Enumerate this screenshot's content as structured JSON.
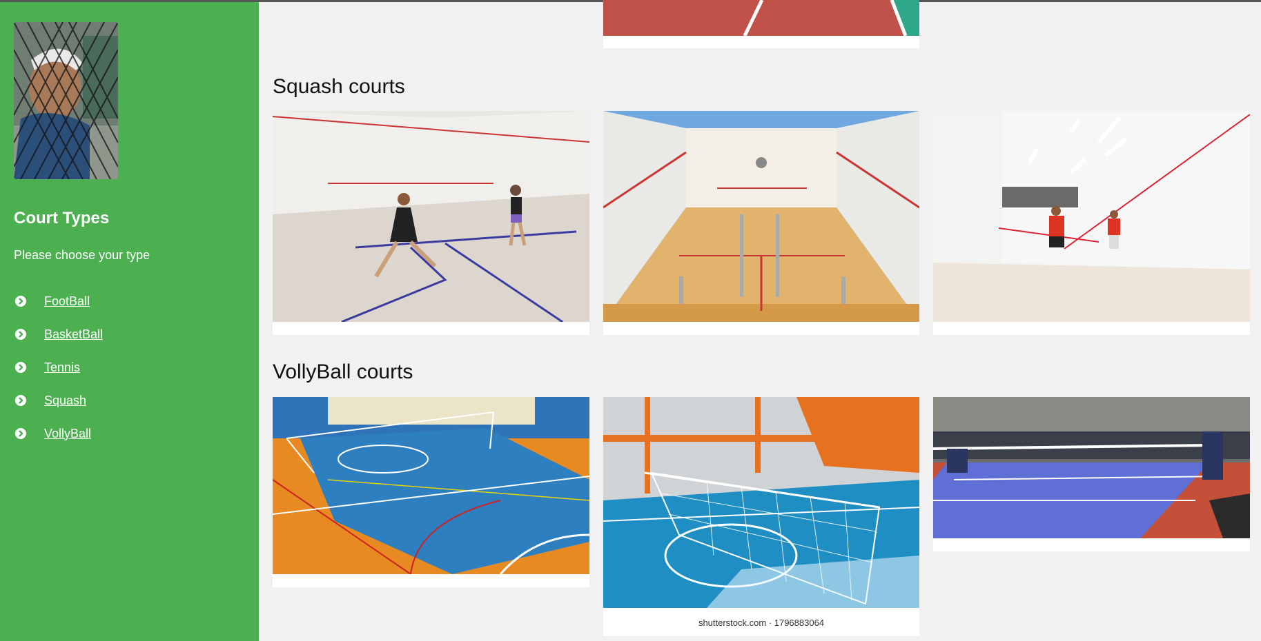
{
  "sidebar": {
    "avatar_icon": "player-photo",
    "title": "Court Types",
    "subtitle": "Please choose your type",
    "nav": [
      {
        "label": "FootBall",
        "icon": "chevron-circle-right-icon"
      },
      {
        "label": "BasketBall",
        "icon": "chevron-circle-right-icon"
      },
      {
        "label": "Tennis",
        "icon": "chevron-circle-right-icon"
      },
      {
        "label": "Squash",
        "icon": "chevron-circle-right-icon"
      },
      {
        "label": "VollyBall",
        "icon": "chevron-circle-right-icon"
      }
    ]
  },
  "sections": {
    "squash": {
      "title": "Squash courts"
    },
    "volleyball": {
      "title": "VollyBall courts"
    }
  },
  "images": {
    "volleyball_2_caption": "shutterstock.com · 1796883064"
  },
  "colors": {
    "sidebar_green": "#4caf50",
    "page_bg": "#f1f1f1"
  }
}
